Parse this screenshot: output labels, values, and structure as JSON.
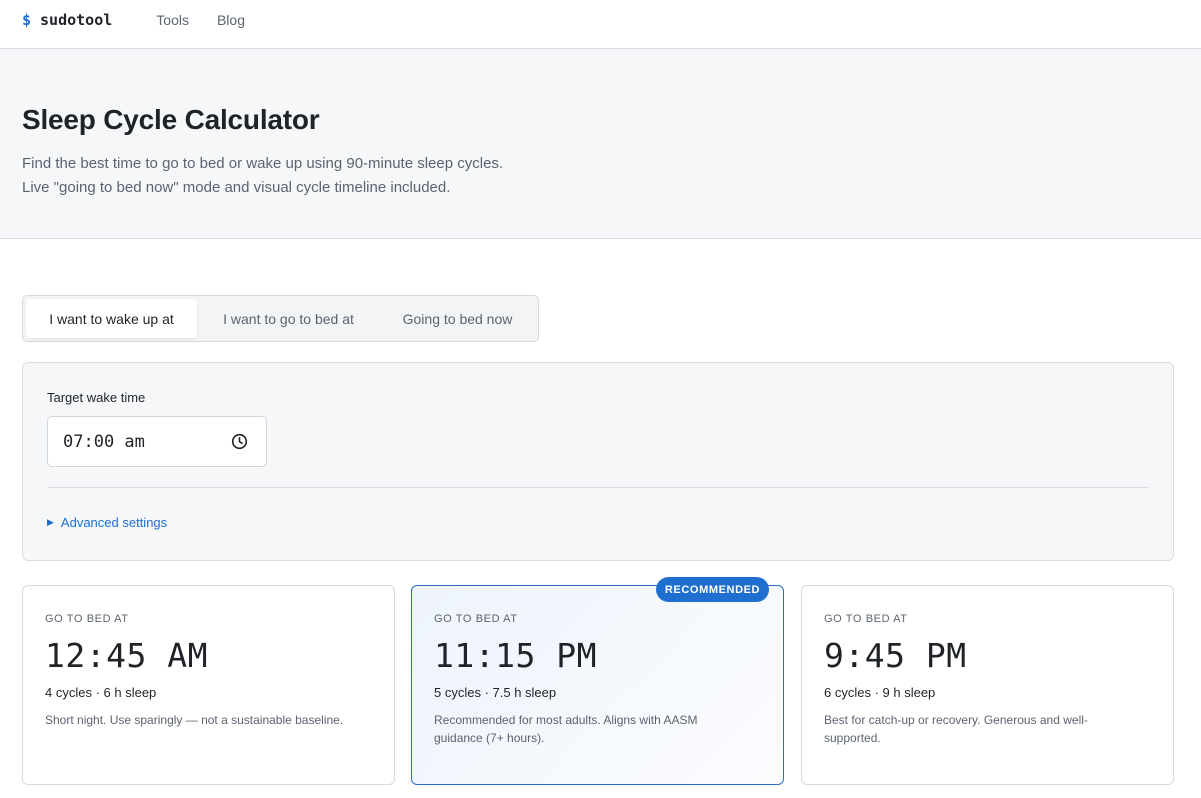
{
  "nav": {
    "logo_symbol": "$",
    "logo_text": "sudotool",
    "links": [
      {
        "label": "Tools"
      },
      {
        "label": "Blog"
      }
    ]
  },
  "hero": {
    "title": "Sleep Cycle Calculator",
    "description_lines": [
      "Find the best time to go to bed or wake up using 90-minute sleep cycles.",
      "Live \"going to bed now\" mode and visual cycle timeline included."
    ]
  },
  "tabs": [
    {
      "label": "I want to wake up at",
      "active": true
    },
    {
      "label": "I want to go to bed at",
      "active": false
    },
    {
      "label": "Going to bed now",
      "active": false
    }
  ],
  "form": {
    "field_label": "Target wake time",
    "time_value": "07:00 am",
    "time_icon": "clock-icon",
    "advanced_icon": "triangle-right-icon",
    "advanced_label": "Advanced settings"
  },
  "results": [
    {
      "eyebrow": "GO TO BED AT",
      "time": "12:45 AM",
      "meta": "4 cycles · 6 h sleep",
      "note": "Short night. Use sparingly — not a sustainable baseline.",
      "recommended": false
    },
    {
      "eyebrow": "GO TO BED AT",
      "time": "11:15 PM",
      "meta": "5 cycles · 7.5 h sleep",
      "note": "Recommended for most adults. Aligns with AASM guidance (7+ hours).",
      "recommended": true,
      "badge": "RECOMMENDED"
    },
    {
      "eyebrow": "GO TO BED AT",
      "time": "9:45 PM",
      "meta": "6 cycles · 9 h sleep",
      "note": "Best for catch-up or recovery. Generous and well-supported.",
      "recommended": false
    }
  ],
  "colors": {
    "accent": "#1f6fd0",
    "recommended_border": "#2c6fc0",
    "panel_background": "#f6f7f9"
  }
}
